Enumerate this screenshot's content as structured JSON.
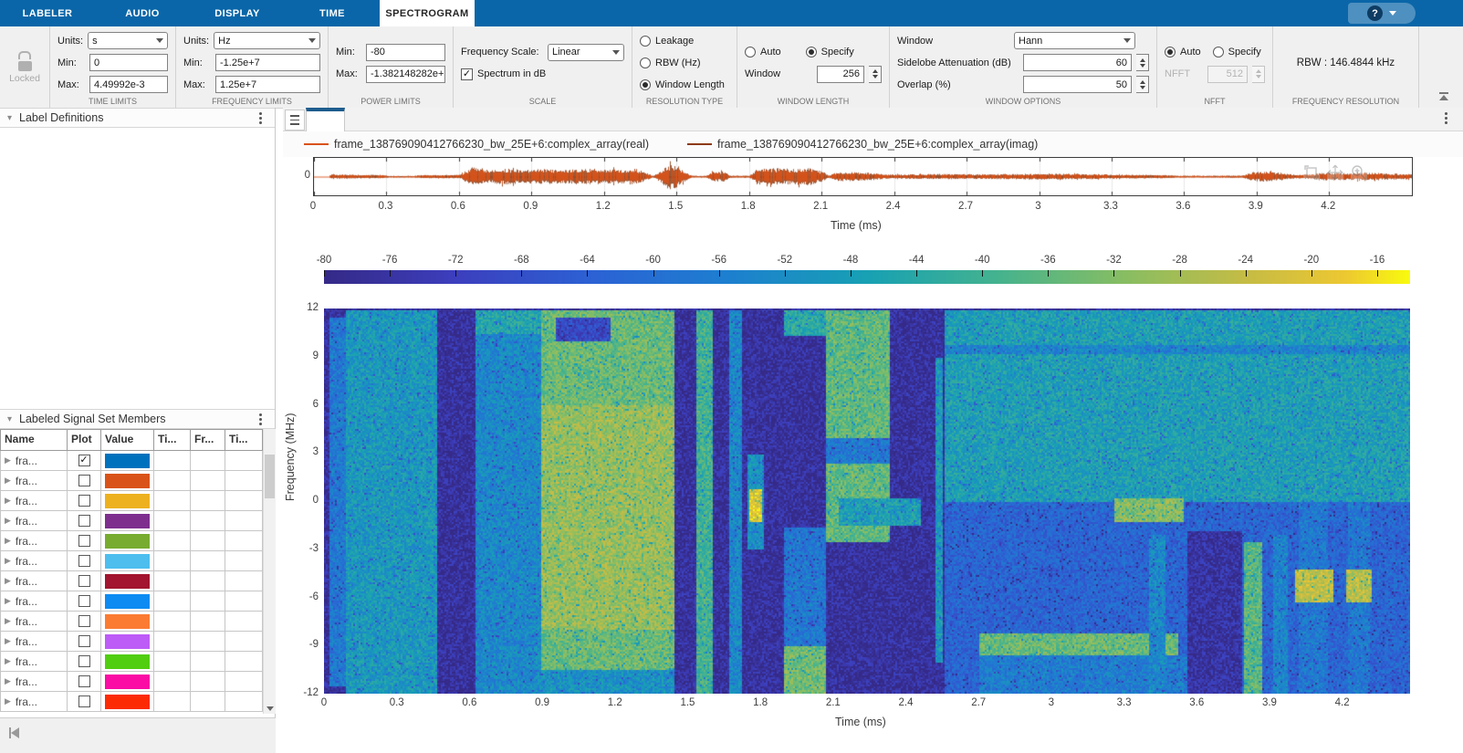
{
  "tabs": {
    "items": [
      {
        "label": "LABELER",
        "active": false
      },
      {
        "label": "AUDIO",
        "active": false
      },
      {
        "label": "DISPLAY",
        "active": false
      },
      {
        "label": "TIME",
        "active": false
      },
      {
        "label": "SPECTROGRAM",
        "active": true
      }
    ],
    "help_label": "?"
  },
  "toolstrip": {
    "locked": {
      "label": "Locked"
    },
    "time_limits": {
      "title": "TIME LIMITS",
      "units_label": "Units:",
      "units": "s",
      "min_label": "Min:",
      "min": "0",
      "max_label": "Max:",
      "max": "4.49992e-3"
    },
    "frequency_limits": {
      "title": "FREQUENCY LIMITS",
      "units_label": "Units:",
      "units": "Hz",
      "min_label": "Min:",
      "min": "-1.25e+7",
      "max_label": "Max:",
      "max": "1.25e+7"
    },
    "power_limits": {
      "title": "POWER LIMITS",
      "min_label": "Min:",
      "min": "-80",
      "max_label": "Max:",
      "max": "-1.382148282e+1"
    },
    "scale": {
      "title": "SCALE",
      "freq_scale_label": "Frequency Scale:",
      "freq_scale": "Linear",
      "spectrum_db_label": "Spectrum in dB",
      "spectrum_db_checked": true
    },
    "resolution_type": {
      "title": "RESOLUTION TYPE",
      "options": [
        {
          "label": "Leakage",
          "selected": false
        },
        {
          "label": "RBW (Hz)",
          "selected": false
        },
        {
          "label": "Window Length",
          "selected": true
        }
      ]
    },
    "window_length": {
      "title": "WINDOW LENGTH",
      "auto_label": "Auto",
      "auto_selected": false,
      "specify_label": "Specify",
      "specify_selected": true,
      "window_label": "Window",
      "window_value": "256"
    },
    "window_options": {
      "title": "WINDOW OPTIONS",
      "window_label": "Window",
      "window": "Hann",
      "sidelobe_label": "Sidelobe Attenuation (dB)",
      "sidelobe": "60",
      "overlap_label": "Overlap (%)",
      "overlap": "50"
    },
    "nfft": {
      "title": "NFFT",
      "auto_label": "Auto",
      "auto_selected": true,
      "specify_label": "Specify",
      "specify_selected": false,
      "nfft_label": "NFFT",
      "nfft_value": "512"
    },
    "frequency_resolution": {
      "title": "FREQUENCY RESOLUTION",
      "rbw": "RBW : 146.4844 kHz"
    }
  },
  "panels": {
    "label_definitions": {
      "title": "Label Definitions"
    },
    "signal_set": {
      "title": "Labeled Signal Set Members",
      "columns": [
        "Name",
        "Plot",
        "Value",
        "Ti...",
        "Fr...",
        "Ti..."
      ],
      "rows": [
        {
          "name": "fra...",
          "checked": true,
          "color": "#0072BD"
        },
        {
          "name": "fra...",
          "checked": false,
          "color": "#D95319"
        },
        {
          "name": "fra...",
          "checked": false,
          "color": "#EDB120"
        },
        {
          "name": "fra...",
          "checked": false,
          "color": "#7E2F8E"
        },
        {
          "name": "fra...",
          "checked": false,
          "color": "#77AC30"
        },
        {
          "name": "fra...",
          "checked": false,
          "color": "#4DBEEE"
        },
        {
          "name": "fra...",
          "checked": false,
          "color": "#A2142F"
        },
        {
          "name": "fra...",
          "checked": false,
          "color": "#0D8BF2"
        },
        {
          "name": "fra...",
          "checked": false,
          "color": "#FB7B33"
        },
        {
          "name": "fra...",
          "checked": false,
          "color": "#BD5CF7"
        },
        {
          "name": "fra...",
          "checked": false,
          "color": "#51CE10"
        },
        {
          "name": "fra...",
          "checked": false,
          "color": "#FA0CA5"
        },
        {
          "name": "fra...",
          "checked": false,
          "color": "#FC2B06"
        }
      ]
    }
  },
  "display": {
    "legend": [
      {
        "label": "frame_138769090412766230_bw_25E+6:complex_array(real)",
        "color": "#D95319"
      },
      {
        "label": "frame_138769090412766230_bw_25E+6:complex_array(imag)",
        "color": "#8C3A10"
      }
    ]
  },
  "chart_data": [
    {
      "type": "line",
      "title": "time-domain waveform of selected complex signal (real and imag parts)",
      "xlabel": "Time (ms)",
      "ylabel": "",
      "xlim": [
        0,
        4.55
      ],
      "ylim": [
        -1,
        1
      ],
      "x_ticks": [
        "0",
        "0.3",
        "0.6",
        "0.9",
        "1.2",
        "1.5",
        "1.8",
        "2.1",
        "2.4",
        "2.7",
        "3",
        "3.3",
        "3.6",
        "3.9",
        "4.2"
      ],
      "y_ticks": [
        "0"
      ],
      "grid": true,
      "series": [
        {
          "name": "frame_138769090412766230_bw_25E+6:complex_array(real)",
          "color": "#D95319"
        },
        {
          "name": "frame_138769090412766230_bw_25E+6:complex_array(imag)",
          "color": "#8C3A10"
        }
      ],
      "amplitude_envelope": [
        [
          0,
          0.02
        ],
        [
          0.06,
          0.02
        ],
        [
          0.07,
          0.13
        ],
        [
          0.17,
          0.11
        ],
        [
          0.28,
          0.1
        ],
        [
          0.31,
          0.04
        ],
        [
          0.41,
          0.04
        ],
        [
          0.44,
          0.09
        ],
        [
          0.6,
          0.1
        ],
        [
          0.63,
          0.3
        ],
        [
          0.655,
          0.55
        ],
        [
          0.68,
          0.45
        ],
        [
          0.73,
          0.38
        ],
        [
          0.8,
          0.46
        ],
        [
          0.88,
          0.4
        ],
        [
          0.95,
          0.44
        ],
        [
          1.05,
          0.4
        ],
        [
          1.15,
          0.46
        ],
        [
          1.25,
          0.42
        ],
        [
          1.33,
          0.46
        ],
        [
          1.37,
          0.25
        ],
        [
          1.4,
          0.04
        ],
        [
          1.43,
          0.3
        ],
        [
          1.46,
          0.72
        ],
        [
          1.5,
          0.68
        ],
        [
          1.53,
          0.3
        ],
        [
          1.56,
          0.05
        ],
        [
          1.62,
          0.04
        ],
        [
          1.65,
          0.28
        ],
        [
          1.7,
          0.3
        ],
        [
          1.72,
          0.06
        ],
        [
          1.8,
          0.05
        ],
        [
          1.83,
          0.42
        ],
        [
          1.9,
          0.5
        ],
        [
          1.97,
          0.46
        ],
        [
          2.05,
          0.5
        ],
        [
          2.1,
          0.3
        ],
        [
          2.13,
          0.08
        ],
        [
          2.16,
          0.25
        ],
        [
          2.22,
          0.28
        ],
        [
          2.3,
          0.22
        ],
        [
          2.37,
          0.12
        ],
        [
          2.45,
          0.13
        ],
        [
          2.6,
          0.16
        ],
        [
          2.75,
          0.14
        ],
        [
          2.9,
          0.16
        ],
        [
          3.05,
          0.18
        ],
        [
          3.2,
          0.15
        ],
        [
          3.35,
          0.11
        ],
        [
          3.5,
          0.1
        ],
        [
          3.57,
          0.05
        ],
        [
          3.7,
          0.05
        ],
        [
          3.84,
          0.06
        ],
        [
          3.88,
          0.26
        ],
        [
          3.94,
          0.3
        ],
        [
          4.0,
          0.22
        ],
        [
          4.06,
          0.1
        ],
        [
          4.13,
          0.15
        ],
        [
          4.18,
          0.24
        ],
        [
          4.27,
          0.2
        ],
        [
          4.36,
          0.22
        ],
        [
          4.45,
          0.18
        ],
        [
          4.55,
          0.15
        ]
      ]
    },
    {
      "type": "heatmap",
      "title": "spectrogram of selected signal",
      "xlabel": "Time (ms)",
      "ylabel": "Frequency (MHz)",
      "xlim": [
        0,
        4.48
      ],
      "ylim": [
        -12,
        12
      ],
      "x_ticks": [
        "0",
        "0.3",
        "0.6",
        "0.9",
        "1.2",
        "1.5",
        "1.8",
        "2.1",
        "2.4",
        "2.7",
        "3",
        "3.3",
        "3.6",
        "3.9",
        "4.2"
      ],
      "y_ticks": [
        "12",
        "9",
        "6",
        "3",
        "0",
        "-3",
        "-6",
        "-9",
        "-12"
      ],
      "colorbar": {
        "position": "top",
        "vmin": -80,
        "vmax": -14,
        "ticks": [
          "-80",
          "-76",
          "-72",
          "-68",
          "-64",
          "-60",
          "-56",
          "-52",
          "-48",
          "-44",
          "-40",
          "-36",
          "-32",
          "-28",
          "-24",
          "-20",
          "-16"
        ]
      },
      "colormap": "parula",
      "colormap_stops": [
        [
          0.0,
          "#352A87"
        ],
        [
          0.12,
          "#3D3FBE"
        ],
        [
          0.25,
          "#2C63D5"
        ],
        [
          0.37,
          "#1E7FD0"
        ],
        [
          0.5,
          "#18A1B4"
        ],
        [
          0.62,
          "#45B38F"
        ],
        [
          0.74,
          "#8ABE62"
        ],
        [
          0.85,
          "#C6BC45"
        ],
        [
          0.94,
          "#EDC832"
        ],
        [
          1.0,
          "#F9FB0E"
        ]
      ],
      "background_db": -77,
      "regions": [
        {
          "t": [
            0.02,
            0.09
          ],
          "f": [
            -11.5,
            11.5
          ],
          "db": -58
        },
        {
          "t": [
            0.09,
            0.46
          ],
          "f": [
            -12,
            12
          ],
          "db": -50
        },
        {
          "t": [
            0.62,
            0.89
          ],
          "f": [
            -12,
            12
          ],
          "db": -54
        },
        {
          "t": [
            0.62,
            0.89
          ],
          "f": [
            10.5,
            12
          ],
          "db": -46
        },
        {
          "t": [
            0.89,
            1.44
          ],
          "f": [
            -12,
            12
          ],
          "db": -36
        },
        {
          "t": [
            0.89,
            1.44
          ],
          "f": [
            -8,
            6
          ],
          "db": -31
        },
        {
          "t": [
            0.95,
            1.18
          ],
          "f": [
            10,
            11.5
          ],
          "db": -70
        },
        {
          "t": [
            0.89,
            1.44
          ],
          "f": [
            -12,
            -10.5
          ],
          "db": -52
        },
        {
          "t": [
            1.53,
            1.6
          ],
          "f": [
            -12,
            12
          ],
          "db": -41
        },
        {
          "t": [
            1.67,
            1.72
          ],
          "f": [
            -12,
            12
          ],
          "db": -54
        },
        {
          "t": [
            1.74,
            1.81
          ],
          "f": [
            -3,
            3
          ],
          "db": -52
        },
        {
          "t": [
            1.75,
            1.8
          ],
          "f": [
            -1.3,
            0.8
          ],
          "db": -22
        },
        {
          "t": [
            1.89,
            2.07
          ],
          "f": [
            10.3,
            12
          ],
          "db": -45
        },
        {
          "t": [
            1.89,
            2.07
          ],
          "f": [
            -9,
            -1.6
          ],
          "db": -58
        },
        {
          "t": [
            1.89,
            2.07
          ],
          "f": [
            -12,
            -9
          ],
          "db": -35
        },
        {
          "t": [
            2.07,
            2.33
          ],
          "f": [
            -2.5,
            12
          ],
          "db": -37
        },
        {
          "t": [
            2.07,
            2.33
          ],
          "f": [
            2.4,
            4
          ],
          "db": -58
        },
        {
          "t": [
            2.12,
            2.46
          ],
          "f": [
            -1.5,
            0.2
          ],
          "db": -48
        },
        {
          "t": [
            2.52,
            2.55
          ],
          "f": [
            -10,
            9
          ],
          "db": -50
        },
        {
          "t": [
            2.56,
            4.48
          ],
          "f": [
            0,
            12
          ],
          "db": -48
        },
        {
          "t": [
            2.56,
            4.48
          ],
          "f": [
            9.2,
            9.8
          ],
          "db": -55
        },
        {
          "t": [
            2.56,
            4.48
          ],
          "f": [
            -12,
            0
          ],
          "db": -63
        },
        {
          "t": [
            3.26,
            3.54
          ],
          "f": [
            -1.2,
            0.2
          ],
          "db": -33
        },
        {
          "t": [
            2.7,
            3.52
          ],
          "f": [
            -9.5,
            -8.2
          ],
          "db": -36
        },
        {
          "t": [
            2.7,
            3.56
          ],
          "f": [
            -12,
            -9.5
          ],
          "db": -57
        },
        {
          "t": [
            3.4,
            3.47
          ],
          "f": [
            -12,
            -2
          ],
          "db": -54
        },
        {
          "t": [
            3.56,
            3.78
          ],
          "f": [
            -12,
            -1.8
          ],
          "db": -76
        },
        {
          "t": [
            3.79,
            3.87
          ],
          "f": [
            -12,
            -2.5
          ],
          "db": -38
        },
        {
          "t": [
            3.91,
            3.97
          ],
          "f": [
            -12,
            -2
          ],
          "db": -55
        },
        {
          "t": [
            4.02,
            4.14
          ],
          "f": [
            -12,
            0
          ],
          "db": -58
        },
        {
          "t": [
            4.22,
            4.31
          ],
          "f": [
            -12,
            0
          ],
          "db": -58
        },
        {
          "t": [
            4.0,
            4.16
          ],
          "f": [
            -6.3,
            -4.2
          ],
          "db": -26
        },
        {
          "t": [
            4.21,
            4.32
          ],
          "f": [
            -6.3,
            -4.2
          ],
          "db": -27
        }
      ]
    }
  ]
}
